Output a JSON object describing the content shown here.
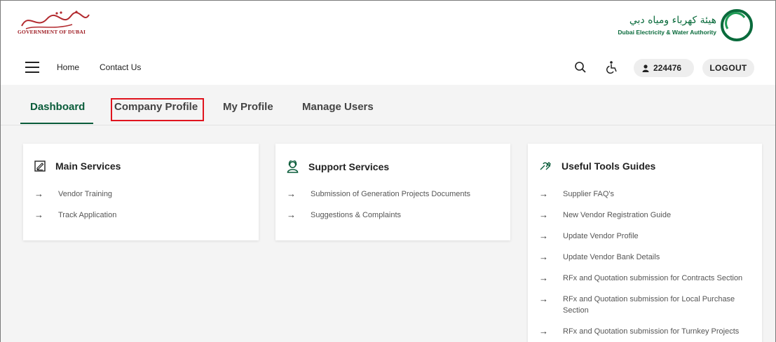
{
  "brand": {
    "gov_name": "GOVERNMENT OF DUBAI",
    "dewa_ar": "هيئة كهرباء ومياه دبي",
    "dewa_en": "Dubai Electricity & Water Authority"
  },
  "nav": {
    "menu_icon": "hamburger-icon",
    "home": "Home",
    "contact": "Contact Us",
    "search_icon": "search-icon",
    "accessibility_icon": "accessibility-icon",
    "user_icon": "user-icon",
    "user_id": "224476",
    "logout": "LOGOUT"
  },
  "tabs": [
    {
      "label": "Dashboard",
      "active": true
    },
    {
      "label": "Company Profile",
      "active": false,
      "highlighted": true
    },
    {
      "label": "My Profile",
      "active": false
    },
    {
      "label": "Manage Users",
      "active": false
    }
  ],
  "cards": [
    {
      "title": "Main Services",
      "icon": "edit-document-icon",
      "items": [
        "Vendor Training",
        "Track Application"
      ]
    },
    {
      "title": "Support Services",
      "icon": "support-agent-icon",
      "items": [
        "Submission of Generation Projects Documents",
        "Suggestions & Complaints"
      ]
    },
    {
      "title": "Useful Tools Guides",
      "icon": "tools-icon",
      "items": [
        "Supplier FAQ's",
        "New Vendor Registration Guide",
        "Update Vendor Profile",
        "Update Vendor Bank Details",
        "RFx and Quotation submission for Contracts Section",
        "RFx and Quotation submission for Local Purchase Section",
        "RFx and Quotation submission for Turnkey Projects"
      ]
    }
  ],
  "colors": {
    "accent_green": "#0a5c3a",
    "highlight_red": "#e0141e",
    "gov_red": "#9e1b22"
  }
}
